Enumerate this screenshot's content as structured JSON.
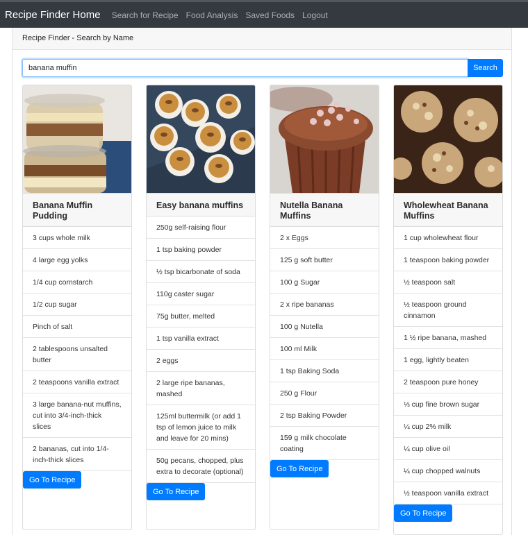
{
  "nav": {
    "brand": "Recipe Finder Home",
    "links": [
      "Search for Recipe",
      "Food Analysis",
      "Saved Foods",
      "Logout"
    ]
  },
  "header": {
    "title": "Recipe Finder - Search by Name"
  },
  "search": {
    "value": "banana muffin",
    "button_label": "Search"
  },
  "go_label": "Go To Recipe",
  "recipes": [
    {
      "title": "Banana Muffin Pudding",
      "ingredients": [
        "3 cups whole milk",
        "4 large egg yolks",
        "1/4 cup cornstarch",
        "1/2 cup sugar",
        "Pinch of salt",
        "2 tablespoons unsalted butter",
        "2 teaspoons vanilla extract",
        "3 large banana-nut muffins, cut into 3/4-inch-thick slices",
        "2 bananas, cut into 1/4-inch-thick slices"
      ]
    },
    {
      "title": "Easy banana muffins",
      "ingredients": [
        "250g self-raising flour",
        "1 tsp baking powder",
        "½ tsp bicarbonate of soda",
        "110g caster sugar",
        "75g butter, melted",
        "1 tsp vanilla extract",
        "2 eggs",
        "2 large ripe bananas, mashed",
        "125ml buttermilk (or add 1 tsp of lemon juice to milk and leave for 20 mins)",
        "50g pecans, chopped, plus extra to decorate (optional)"
      ]
    },
    {
      "title": "Nutella Banana Muffins",
      "ingredients": [
        "2 x Eggs",
        "125 g soft butter",
        "100 g Sugar",
        "2 x ripe bananas",
        "100 g Nutella",
        "100 ml Milk",
        "1 tsp Baking Soda",
        "250 g Flour",
        "2 tsp Baking Powder",
        "159 g milk chocolate coating"
      ]
    },
    {
      "title": "Wholewheat Banana Muffins",
      "ingredients": [
        "1 cup wholewheat flour",
        "1 teaspoon baking powder",
        "½ teaspoon salt",
        "½ teaspoon ground cinnamon",
        "1 ½ ripe banana, mashed",
        "1 egg, lightly beaten",
        "2 teaspoon pure honey",
        "⅓ cup fine brown sugar",
        "¼ cup 2% milk",
        "¼ cup olive oil",
        "¼ cup chopped walnuts",
        "½ teaspoon vanilla extract"
      ]
    }
  ]
}
